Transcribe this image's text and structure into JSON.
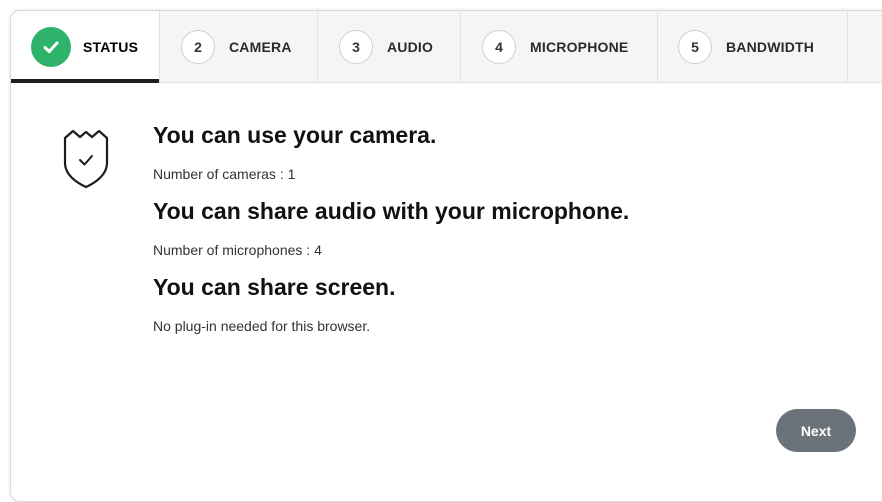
{
  "tabs": [
    {
      "step": "",
      "label": "STATUS",
      "active": true
    },
    {
      "step": "2",
      "label": "CAMERA",
      "active": false
    },
    {
      "step": "3",
      "label": "AUDIO",
      "active": false
    },
    {
      "step": "4",
      "label": "MICROPHONE",
      "active": false
    },
    {
      "step": "5",
      "label": "BANDWIDTH",
      "active": false
    }
  ],
  "status": {
    "icon": "shield-check-icon",
    "items": [
      {
        "heading": "You can use your camera.",
        "detail": "Number of cameras : 1"
      },
      {
        "heading": "You can share audio with your microphone.",
        "detail": "Number of microphones : 4"
      },
      {
        "heading": "You can share screen.",
        "detail": "No plug-in needed for this browser."
      }
    ]
  },
  "next_button": {
    "label": "Next"
  },
  "colors": {
    "success": "#2fb36b",
    "active_underline": "#1f1f1f",
    "tabbar_bg": "#f5f5f5",
    "button_bg": "#6b7279"
  }
}
